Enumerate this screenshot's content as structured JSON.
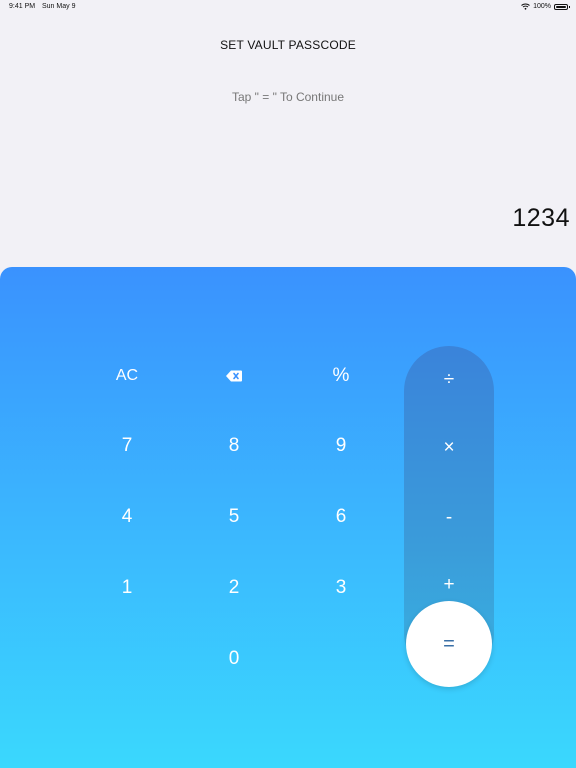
{
  "status_bar": {
    "time": "9:41 PM",
    "date": "Sun May 9",
    "battery": "100%",
    "icons": [
      "wifi-icon",
      "battery-icon"
    ]
  },
  "header": {
    "title": "SET VAULT PASSCODE",
    "subtitle": "Tap \" = \" To Continue"
  },
  "display": {
    "value": "1234"
  },
  "keypad": {
    "clear": "AC",
    "backspace_icon": "backspace-icon",
    "percent": "%",
    "digits": {
      "seven": "7",
      "eight": "8",
      "nine": "9",
      "four": "4",
      "five": "5",
      "six": "6",
      "one": "1",
      "two": "2",
      "three": "3",
      "zero": "0"
    },
    "operators": {
      "divide": "÷",
      "multiply": "×",
      "minus": "-",
      "plus": "+",
      "equals": "="
    }
  },
  "colors": {
    "background": "#f2f1f6",
    "keypad_top": "#3a92fe",
    "keypad_bottom": "#3ad8fd",
    "operator_column": "#3a82d8",
    "equals_bg": "#ffffff"
  }
}
